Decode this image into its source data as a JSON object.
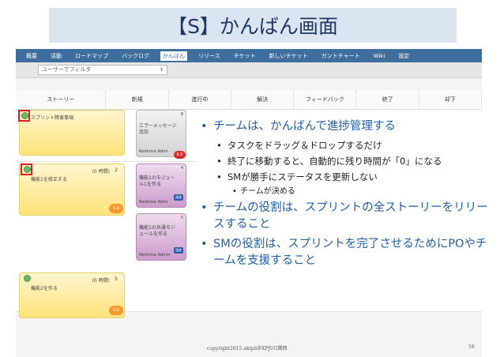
{
  "slide": {
    "title": "【S】かんばん画面",
    "footer_copyright": "copyright2015 akipii＠XPJUG関西",
    "page_number": "16"
  },
  "menu": {
    "items": [
      "概要",
      "活動",
      "ロードマップ",
      "バックログ",
      "かんばん",
      "リリース",
      "チケット",
      "新しいチケット",
      "ガントチャート",
      "Wiki",
      "設定"
    ],
    "active_index": 4
  },
  "filter": {
    "value": "ユーザーでフィルタ",
    "arrow": "⬍"
  },
  "board": {
    "columns": [
      "ストーリー",
      "新規",
      "進行中",
      "解決",
      "フィードバック",
      "終了",
      "却下"
    ],
    "lanes": [
      {
        "story": {
          "title": "スプリント障害事項",
          "hours": "",
          "points": ""
        },
        "new_cards": [
          {
            "title": "エラーメッセージ追加",
            "assignee": "Redmine Admi",
            "estimate": "6.0",
            "num": "8",
            "color": "gray"
          }
        ]
      },
      {
        "story": {
          "title": "機能1を修正する",
          "hours": "(0 時間)",
          "points": "2",
          "estimate": "5.0"
        },
        "new_cards": [
          {
            "title": "機能1のモジュール1を作る",
            "assignee": "Redmine Admi",
            "estimate": "",
            "num": "4",
            "tag": "速度",
            "color": "pink"
          },
          {
            "title": "機能1の共通モジュールを作る",
            "assignee": "Redmine Admin",
            "estimate": "",
            "num": "5",
            "tag": "速度",
            "color": "pink"
          }
        ]
      },
      {
        "story": {
          "title": "機能2を作る",
          "hours": "(0 時間)",
          "points": "5",
          "estimate": "6.0"
        },
        "new_cards": []
      }
    ]
  },
  "bullets": {
    "l1a": "チームは、かんばんで進捗管理する",
    "l2a": "タスクをドラッグ＆ドロップするだけ",
    "l2b": "終了に移動すると、自動的に残り時間が「0」になる",
    "l2c": "SMが勝手にステータスを更新しない",
    "l3a": "チームが決める",
    "l1b": "チームの役割は、スプリントの全ストーリーをリリースすること",
    "l1c": "SMの役割は、スプリントを完了させるためにPOやチームを支援すること"
  }
}
